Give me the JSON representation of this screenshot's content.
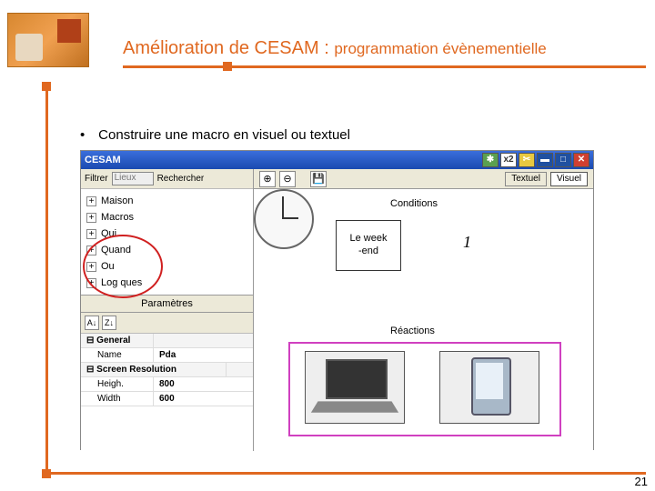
{
  "slide": {
    "title_main": "Amélioration de CESAM :",
    "title_sub": "programmation évènementielle",
    "bullet1": "Construire une macro en visuel ou textuel",
    "page_number": "21"
  },
  "app": {
    "titlebar": "CESAM",
    "tbtns": {
      "star": "✱",
      "x2": "x2",
      "cut": "✂",
      "min": "▬",
      "max": "□",
      "close": "✕"
    },
    "filter": {
      "label": "Filtrer",
      "field_value": "Lieux",
      "search": "Rechercher"
    },
    "tree": {
      "items": [
        "Maison",
        "Macros",
        "Qui",
        "Quand",
        "Ou",
        "Log ques"
      ]
    },
    "params": {
      "header": "Paramètres",
      "tools": {
        "sort_az": "A↓",
        "sort_za": "Z↓"
      },
      "group_general": "General",
      "name_label": "Name",
      "name_value": "Pda",
      "group_screen": "Screen Resolution",
      "height_label": "Heigh.",
      "height_value": "800",
      "width_label": "Width",
      "width_value": "600"
    },
    "toolbar": {
      "zoom_in": "⊕",
      "zoom_out": "⊖",
      "save": "💾",
      "mode_text": "Textuel",
      "mode_visual": "Visuel"
    },
    "canvas": {
      "conditions_label": "Conditions",
      "reactions_label": "Réactions",
      "weekend_l1": "Le week",
      "weekend_l2": "-end",
      "clock_num": "1"
    }
  }
}
